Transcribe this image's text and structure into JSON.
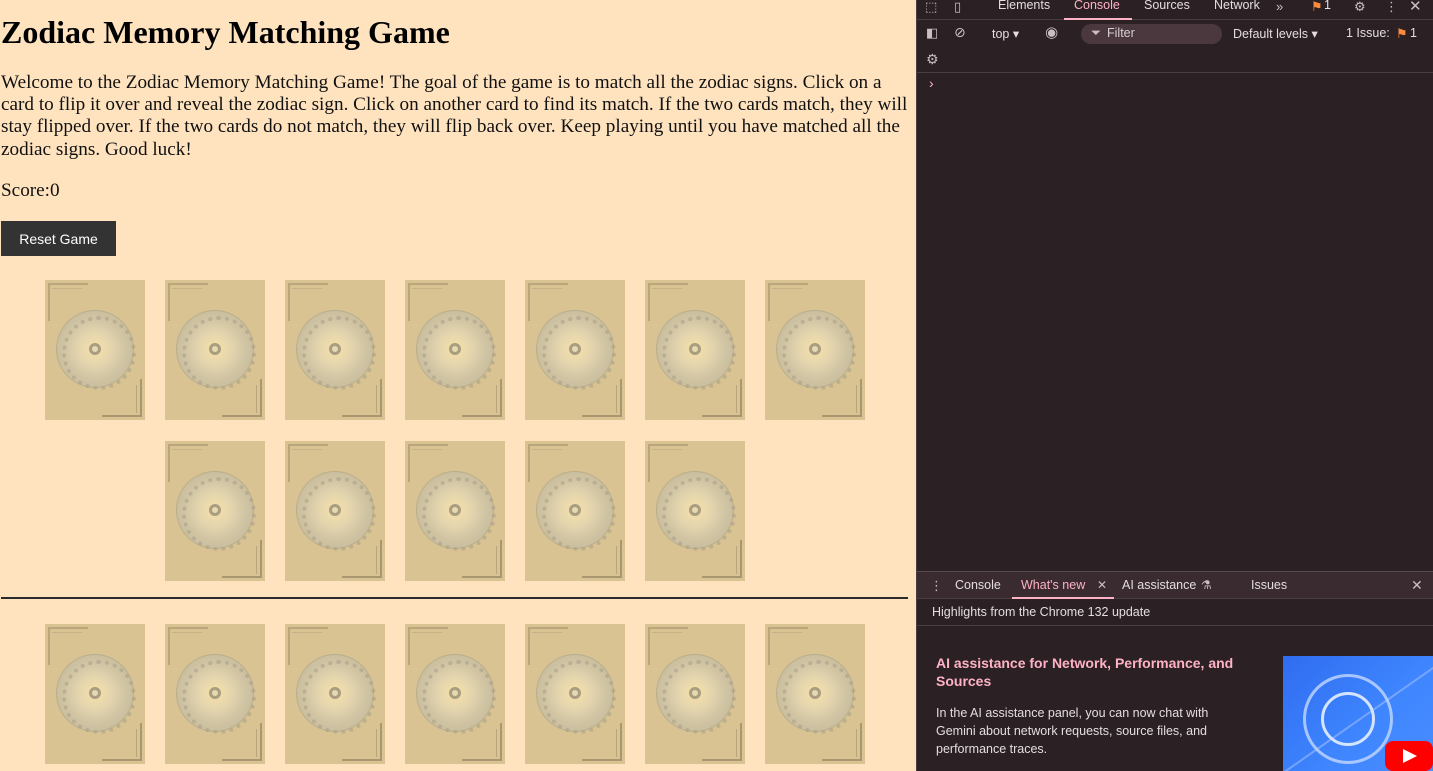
{
  "page": {
    "title": "Zodiac Memory Matching Game",
    "intro": "Welcome to the Zodiac Memory Matching Game! The goal of the game is to match all the zodiac signs. Click on a card to flip it over and reveal the zodiac sign. Click on another card to find its match. If the two cards match, they will stay flipped over. If the two cards do not match, they will flip back over. Keep playing until you have matched all the zodiac signs. Good luck!",
    "score_label": "Score:",
    "score_value": "0",
    "reset_label": "Reset Game",
    "board_top_card_count": 12,
    "board_bottom_visible_card_count": 7,
    "card_back_color": "#d9c393",
    "background_color": "#ffe3bf"
  },
  "devtools": {
    "tabs": [
      "Elements",
      "Console",
      "Sources",
      "Network"
    ],
    "active_tab": "Console",
    "more_tabs_icon": "chevron-double-right-icon",
    "issue_badge_count": "1",
    "context_select": "top",
    "filter_placeholder": "Filter",
    "levels_select": "Default levels",
    "issues_label": "1 Issue:",
    "issues_count": "1",
    "prompt_symbol": "›",
    "drawer": {
      "tabs": [
        "Console",
        "What's new",
        "AI assistance",
        "Issues"
      ],
      "active_tab": "What's new",
      "highlights_title": "Highlights from the Chrome 132 update",
      "feature_title": "AI assistance for Network, Performance, and Sources",
      "feature_body": "In the AI assistance panel, you can now chat with Gemini about network requests, source files, and performance traces."
    },
    "colors": {
      "background": "#2b2124",
      "accent": "#ffb1c5",
      "badge": "#ff8a3d"
    }
  }
}
